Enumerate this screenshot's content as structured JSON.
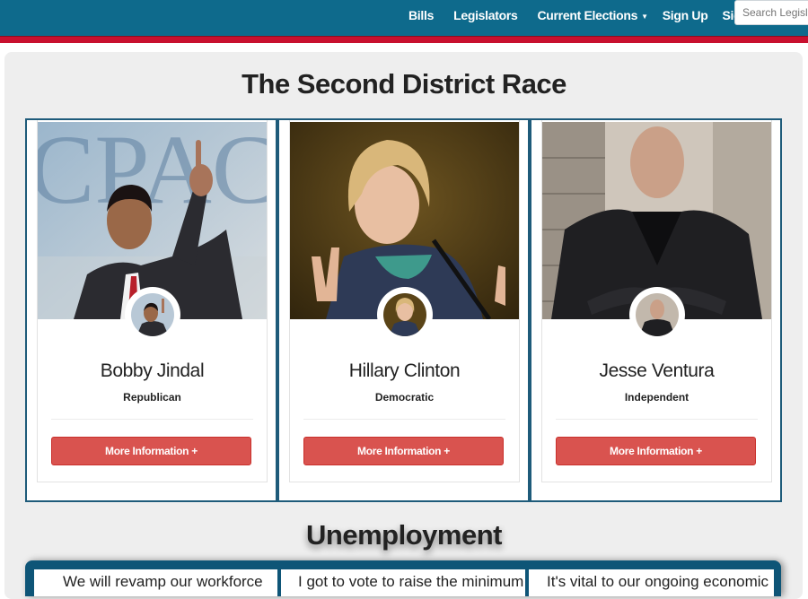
{
  "nav": {
    "links": [
      "Bills",
      "Legislators",
      "Current Elections",
      "Sign Up",
      "Sign In"
    ],
    "search_placeholder": "Search Legislators"
  },
  "race": {
    "title": "The Second District Race",
    "candidates": [
      {
        "name": "Bobby Jindal",
        "party": "Republican",
        "button": "More Information +"
      },
      {
        "name": "Hillary Clinton",
        "party": "Democratic",
        "button": "More Information +"
      },
      {
        "name": "Jesse Ventura",
        "party": "Independent",
        "button": "More Information +"
      }
    ]
  },
  "issue": {
    "title": "Unemployment",
    "statements": [
      "We will revamp our workforce",
      "I got to vote to raise the minimum",
      "It's vital to our ongoing economic"
    ]
  },
  "colors": {
    "navbar": "#0e6a8c",
    "stripe": "#c8102e",
    "button": "#d9534f",
    "card_border": "#1e5b7a"
  },
  "icons": [
    "chevron-down-icon"
  ]
}
